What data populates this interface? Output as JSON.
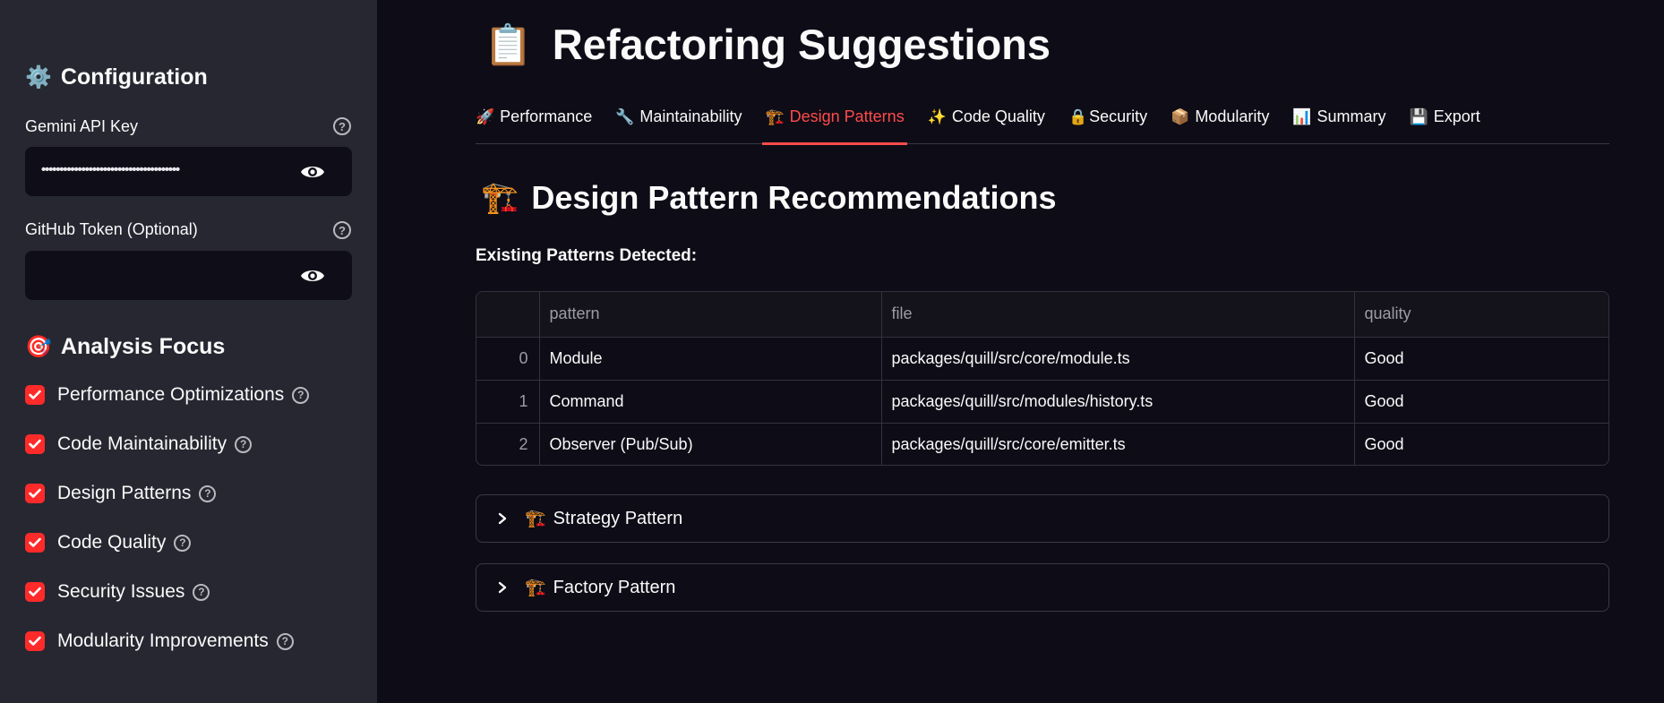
{
  "sidebar": {
    "config_heading": "Configuration",
    "config_icon": "⚙️",
    "api_key_label": "Gemini API Key",
    "api_key_value": "••••••••••••••••••••••••••••••••••••••",
    "github_label": "GitHub Token (Optional)",
    "github_value": "",
    "focus_heading": "Analysis Focus",
    "focus_icon": "🎯",
    "focus_items": [
      {
        "label": "Performance Optimizations",
        "checked": true
      },
      {
        "label": "Code Maintainability",
        "checked": true
      },
      {
        "label": "Design Patterns",
        "checked": true
      },
      {
        "label": "Code Quality",
        "checked": true
      },
      {
        "label": "Security Issues",
        "checked": true
      },
      {
        "label": "Modularity Improvements",
        "checked": true
      }
    ]
  },
  "main": {
    "title": "Refactoring Suggestions",
    "title_icon": "📋",
    "tabs": [
      {
        "icon": "🚀",
        "label": "Performance"
      },
      {
        "icon": "🔧",
        "label": "Maintainability"
      },
      {
        "icon": "🏗️",
        "label": "Design Patterns",
        "active": true
      },
      {
        "icon": "✨",
        "label": "Code Quality"
      },
      {
        "icon": "🔒",
        "label": "Security"
      },
      {
        "icon": "📦",
        "label": "Modularity"
      },
      {
        "icon": "📊",
        "label": "Summary"
      },
      {
        "icon": "💾",
        "label": "Export"
      }
    ],
    "section_title": "Design Pattern Recommendations",
    "section_icon": "🏗️",
    "existing_label": "Existing Patterns Detected:",
    "table": {
      "columns": [
        "",
        "pattern",
        "file",
        "quality"
      ],
      "rows": [
        [
          "0",
          "Module",
          "packages/quill/src/core/module.ts",
          "Good"
        ],
        [
          "1",
          "Command",
          "packages/quill/src/modules/history.ts",
          "Good"
        ],
        [
          "2",
          "Observer (Pub/Sub)",
          "packages/quill/src/core/emitter.ts",
          "Good"
        ]
      ]
    },
    "expanders": [
      {
        "icon": "🏗️",
        "label": "Strategy Pattern"
      },
      {
        "icon": "🏗️",
        "label": "Factory Pattern"
      }
    ]
  },
  "colors": {
    "accent": "#ff4b4b",
    "checkbox": "#ff2b2b",
    "sidebar_bg": "#262730",
    "main_bg": "#0e0c16"
  }
}
